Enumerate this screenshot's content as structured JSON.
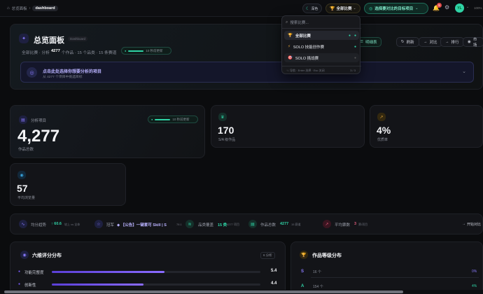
{
  "topbar": {
    "breadcrumb_home": "总览面板",
    "breadcrumb_current": "dashboard",
    "theme_label": "深色",
    "competition_select": "全部比赛",
    "target_select": "选择要对比的目标项目",
    "notification_count": "5",
    "avatar_initials": "YL",
    "zoom": "100%"
  },
  "dropdown": {
    "search_placeholder": "搜索比赛...",
    "items": [
      {
        "label": "全部比赛",
        "icon": "trophy-icon"
      },
      {
        "label": "SOLO 技能创作赛",
        "icon": "bolt-icon"
      },
      {
        "label": "SOLO 挑战赛",
        "icon": "target-icon"
      }
    ],
    "footer_hint": "↑↓ 导航 · Enter 选择 · Esc 关闭",
    "footer_count": "3 / 3"
  },
  "header": {
    "title": "总览面板",
    "badge": "Dashboard",
    "subtitle_prefix": "全部比赛 · 分析",
    "subtitle_count": "4277",
    "subtitle_suffix": "个作品 · 15 个品类 · 15 条赛道",
    "updated": "10 秒前更新",
    "actions": [
      "明细表",
      "刷新",
      "对比",
      "排行",
      "市场"
    ],
    "project_prompt": "点击此处选择你想要分析的项目",
    "project_prompt_sub": "从 4277 个项目中挑选目标"
  },
  "stats": {
    "analyzed": {
      "label": "分析项目",
      "value": "4,277",
      "caption": "作品总数",
      "updated": "10 秒前更新"
    },
    "sa": {
      "value": "170",
      "caption": "S/A 级作品"
    },
    "rate": {
      "value": "4%",
      "caption": "优质率"
    },
    "views": {
      "value": "57",
      "caption": "平均浏览量"
    }
  },
  "strip": {
    "trend_label": "均分趋势",
    "trend_value": "↑ 60.6",
    "trend_sub": "较上 vs 全体",
    "champion_label": "冠军",
    "champion_value": "◆ 【公告】一键套可 Skill | S",
    "champion_sub": "78.1",
    "coverage_label": "品类覆盖",
    "coverage_value": "15 类",
    "coverage_sub": "4277 项目",
    "total_label": "作品总数",
    "total_value": "4277",
    "total_sub": "15 赛道",
    "votes_label": "平均票数",
    "votes_value": "3",
    "votes_sub": "票/项目",
    "compare_label": "开始对比"
  },
  "radar": {
    "title": "六维评分分布",
    "badge": "6 分析",
    "rows": [
      {
        "label": "功能完整度",
        "value": "5.4",
        "fill": 0.54
      },
      {
        "label": "创新性",
        "value": "4.4",
        "fill": 0.44
      }
    ]
  },
  "grades": {
    "title": "作品等级分布",
    "rows": [
      {
        "grade": "S",
        "count": "16 个",
        "pct": "0%"
      },
      {
        "grade": "A",
        "count": "154 个",
        "pct": "4%"
      }
    ]
  },
  "colors": {
    "accent": "#2fd3a6",
    "purple": "#7b5cff",
    "amber": "#e0a23a"
  }
}
